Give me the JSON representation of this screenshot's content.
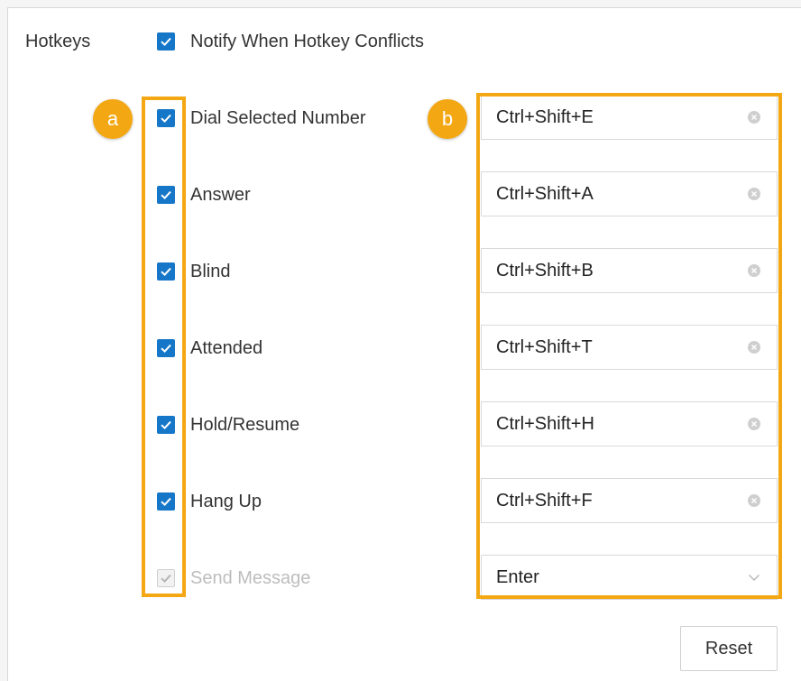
{
  "section_label": "Hotkeys",
  "notify_conflicts": {
    "label": "Notify When Hotkey Conflicts",
    "checked": true
  },
  "rows": [
    {
      "label": "Dial Selected Number",
      "hotkey": "Ctrl+Shift+E",
      "checked": true
    },
    {
      "label": "Answer",
      "hotkey": "Ctrl+Shift+A",
      "checked": true
    },
    {
      "label": "Blind",
      "hotkey": "Ctrl+Shift+B",
      "checked": true
    },
    {
      "label": "Attended",
      "hotkey": "Ctrl+Shift+T",
      "checked": true
    },
    {
      "label": "Hold/Resume",
      "hotkey": "Ctrl+Shift+H",
      "checked": true
    },
    {
      "label": "Hang Up",
      "hotkey": "Ctrl+Shift+F",
      "checked": true
    },
    {
      "label": "Send Message",
      "hotkey": "Enter",
      "checked": true,
      "disabled": true
    }
  ],
  "callouts": {
    "a": "a",
    "b": "b"
  },
  "reset_label": "Reset",
  "colors": {
    "accent": "#1677c9",
    "highlight": "#f3a712"
  },
  "icons": {
    "checkbox": "check-icon",
    "clear": "clear-circle-icon",
    "dropdown": "chevron-down-icon"
  }
}
